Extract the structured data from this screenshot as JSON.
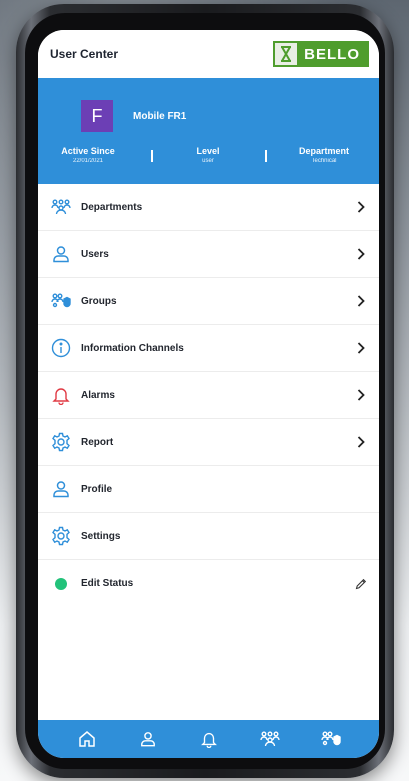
{
  "header": {
    "title": "User Center",
    "logo_text": "BELLO"
  },
  "profile": {
    "avatar_letter": "F",
    "name": "Mobile FR1",
    "stats": [
      {
        "label": "Active Since",
        "value": "22/01/2021"
      },
      {
        "label": "Level",
        "value": "user"
      },
      {
        "label": "Department",
        "value": "Technical"
      }
    ]
  },
  "menu": [
    {
      "label": "Departments",
      "icon": "departments-icon",
      "has_chevron": true
    },
    {
      "label": "Users",
      "icon": "user-icon",
      "has_chevron": true
    },
    {
      "label": "Groups",
      "icon": "groups-icon",
      "has_chevron": true
    },
    {
      "label": "Information Channels",
      "icon": "info-icon",
      "has_chevron": true
    },
    {
      "label": "Alarms",
      "icon": "bell-icon",
      "has_chevron": true
    },
    {
      "label": "Report",
      "icon": "gear-icon",
      "has_chevron": true
    },
    {
      "label": "Profile",
      "icon": "user-icon",
      "has_chevron": false
    },
    {
      "label": "Settings",
      "icon": "gear-icon",
      "has_chevron": false
    },
    {
      "label": "Edit Status",
      "icon": "status-dot-icon",
      "has_chevron": false,
      "trailing": "pencil-icon"
    }
  ],
  "bottom_nav": [
    "home-icon",
    "user-icon",
    "bell-icon",
    "departments-icon",
    "groups-icon"
  ],
  "colors": {
    "primary": "#2f8fd9",
    "logo_green": "#4f9d2d",
    "avatar": "#6c3fb5",
    "alarm_red": "#e03a44",
    "status_green": "#22c27a"
  }
}
